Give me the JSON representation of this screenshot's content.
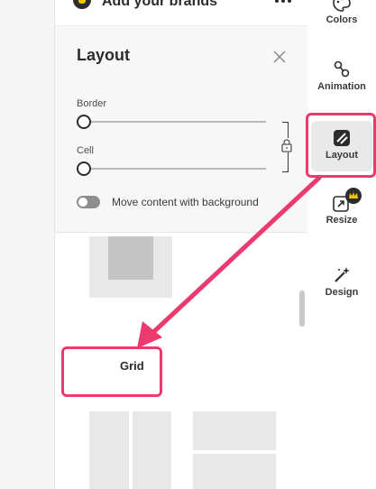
{
  "brand_row": {
    "label": "Add your brands"
  },
  "layout_panel": {
    "title": "Layout",
    "border_label": "Border",
    "cell_label": "Cell",
    "border_value": 0,
    "cell_value": 0,
    "toggle_label": "Move content with background",
    "toggle_on": false
  },
  "section": {
    "grid_label": "Grid"
  },
  "rail": {
    "items": [
      {
        "label": "Colors",
        "icon": "palette-icon",
        "active": false
      },
      {
        "label": "Animation",
        "icon": "animation-icon",
        "active": false
      },
      {
        "label": "Layout",
        "icon": "layout-icon",
        "active": true
      },
      {
        "label": "Resize",
        "icon": "resize-icon",
        "premium": true,
        "active": false
      },
      {
        "label": "Design",
        "icon": "magic-wand-icon",
        "active": false
      }
    ]
  },
  "colors": {
    "annotation": "#ec3a6f",
    "premium_badge": "#f4c400"
  }
}
